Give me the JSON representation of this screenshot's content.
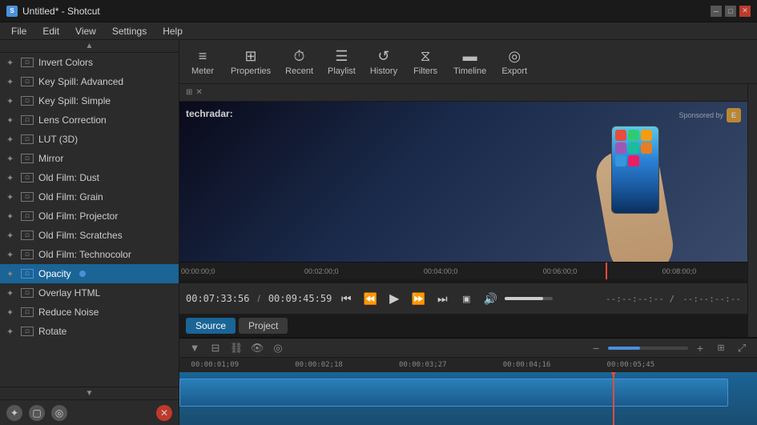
{
  "window": {
    "title": "Untitled* - Shotcut",
    "app_name": "Shotcut"
  },
  "menu": {
    "items": [
      "File",
      "Edit",
      "View",
      "Settings",
      "Help"
    ]
  },
  "toolbar": {
    "buttons": [
      {
        "id": "meter",
        "icon": "≡",
        "label": "Meter"
      },
      {
        "id": "properties",
        "icon": "⊞",
        "label": "Properties"
      },
      {
        "id": "recent",
        "icon": "⏱",
        "label": "Recent"
      },
      {
        "id": "playlist",
        "icon": "☰",
        "label": "Playlist"
      },
      {
        "id": "history",
        "icon": "↺",
        "label": "History"
      },
      {
        "id": "filters",
        "icon": "⧖",
        "label": "Filters"
      },
      {
        "id": "timeline",
        "icon": "▬",
        "label": "Timeline"
      },
      {
        "id": "export",
        "icon": "◎",
        "label": "Export"
      }
    ]
  },
  "filter_panel": {
    "items": [
      {
        "id": "invert-colors",
        "label": "Invert Colors",
        "starred": false
      },
      {
        "id": "key-spill-advanced",
        "label": "Key Spill: Advanced",
        "starred": false
      },
      {
        "id": "key-spill-simple",
        "label": "Key Spill: Simple",
        "starred": false
      },
      {
        "id": "lens-correction",
        "label": "Lens Correction",
        "starred": false
      },
      {
        "id": "lut-3d",
        "label": "LUT (3D)",
        "starred": false
      },
      {
        "id": "mirror",
        "label": "Mirror",
        "starred": false
      },
      {
        "id": "old-film-dust",
        "label": "Old Film: Dust",
        "starred": false
      },
      {
        "id": "old-film-grain",
        "label": "Old Film: Grain",
        "starred": false
      },
      {
        "id": "old-film-projector",
        "label": "Old Film: Projector",
        "starred": false
      },
      {
        "id": "old-film-scratches",
        "label": "Old Film: Scratches",
        "starred": false
      },
      {
        "id": "old-film-technocolor",
        "label": "Old Film: Technocolor",
        "starred": false
      },
      {
        "id": "opacity",
        "label": "Opacity",
        "starred": false,
        "active": true
      },
      {
        "id": "overlay-html",
        "label": "Overlay HTML",
        "starred": false
      },
      {
        "id": "reduce-noise",
        "label": "Reduce Noise",
        "starred": false
      },
      {
        "id": "rotate",
        "label": "Rotate",
        "starred": false
      }
    ],
    "bottom_buttons": [
      "star",
      "monitor",
      "circle"
    ]
  },
  "preview": {
    "watermark": "techradar:",
    "sponsored_text": "Sponsored by",
    "timeline_marks": [
      {
        "time": "00:00:00;0",
        "pos": "0%"
      },
      {
        "time": "00:02:00;0",
        "pos": "22%"
      },
      {
        "time": "00:04:00;0",
        "pos": "43%"
      },
      {
        "time": "00:06:00;0",
        "pos": "65%"
      },
      {
        "time": "00:08:00;0",
        "pos": "87%"
      }
    ]
  },
  "transport": {
    "current_time": "00:07:33:56",
    "total_time": "00:09:45:59",
    "time_separator": "/",
    "volume_level": 80
  },
  "source_tabs": [
    {
      "id": "source",
      "label": "Source",
      "active": true
    },
    {
      "id": "project",
      "label": "Project",
      "active": false
    }
  ],
  "timeline": {
    "time_marks": [
      {
        "time": "00:00:01;09",
        "pos": "2%"
      },
      {
        "time": "00:00:02;18",
        "pos": "20%"
      },
      {
        "time": "00:00:03;27",
        "pos": "38%"
      },
      {
        "time": "00:00:04;16",
        "pos": "56%"
      },
      {
        "time": "00:00:05;45",
        "pos": "74%"
      }
    ]
  }
}
